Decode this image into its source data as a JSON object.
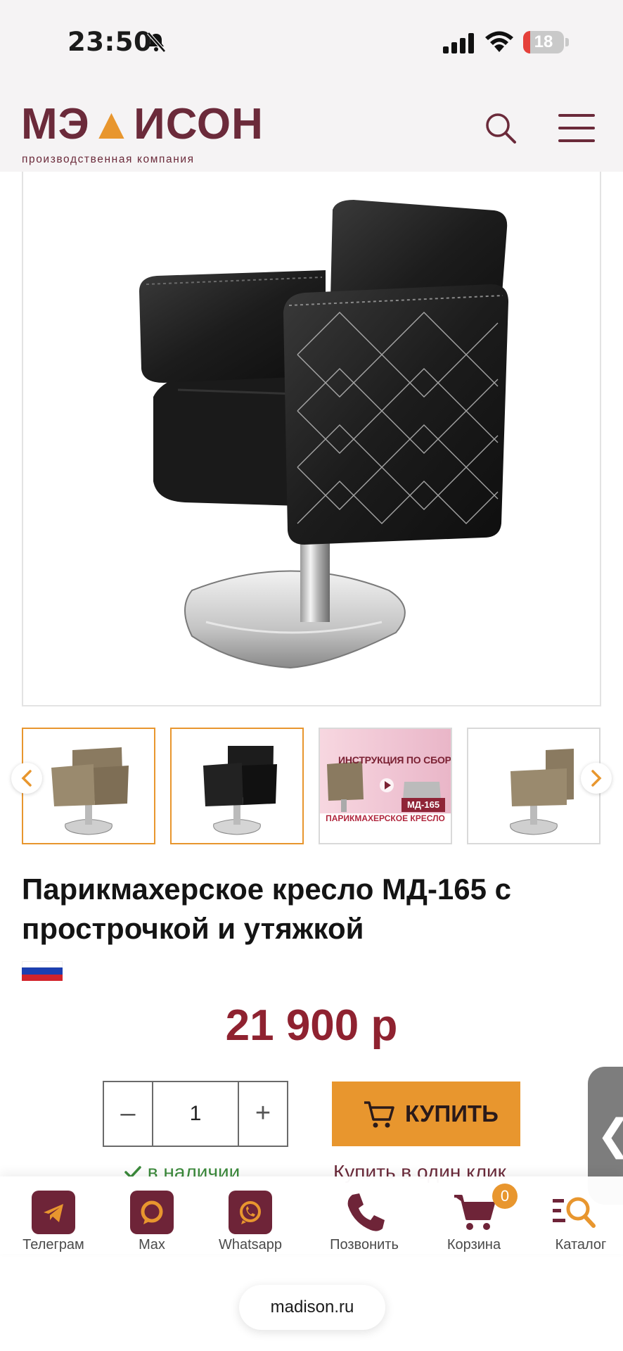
{
  "status_bar": {
    "time": "23:50",
    "battery": "18",
    "battery_level": 0.18
  },
  "header": {
    "logo_text_1": "МЭ",
    "logo_text_2": "ИСОН",
    "logo_tagline": "производственная компания"
  },
  "gallery": {
    "promo_title": "ИНСТРУКЦИЯ ПО СБОРКЕ",
    "promo_model": "МД-165",
    "promo_caption": "ПАРИКМАХЕРСКОЕ КРЕСЛО"
  },
  "product": {
    "title": "Парикмахерское кресло МД-165 с прострочкой и утяжкой",
    "price": "21 900 р",
    "quantity": "1",
    "qty_minus": "–",
    "qty_plus": "+",
    "buy_label": "КУПИТЬ",
    "stock_status": "в наличии",
    "one_click": "Купить в один клик",
    "side_tab_glyph": "❮"
  },
  "bottom_nav": {
    "items": [
      {
        "label": "Телеграм"
      },
      {
        "label": "Max"
      },
      {
        "label": "Whatsapp"
      },
      {
        "label": "Позвонить"
      },
      {
        "label": "Корзина"
      },
      {
        "label": "Каталог"
      }
    ],
    "cart_count": "0"
  },
  "browser": {
    "url": "madison.ru"
  },
  "colors": {
    "brand": "#6b2a3a",
    "accent": "#e8962e",
    "price": "#8f2230"
  }
}
